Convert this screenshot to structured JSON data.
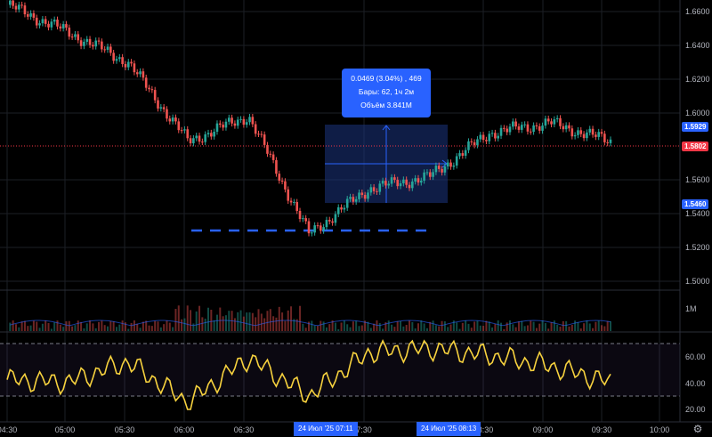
{
  "price_axis": {
    "ticks": [
      "1.6600",
      "1.6400",
      "1.6200",
      "1.6000",
      "1.5600",
      "1.5400",
      "1.5200",
      "1.5000"
    ],
    "tags": {
      "high": {
        "text": "1.5929",
        "color": "#2962ff"
      },
      "current": {
        "text": "1.5802",
        "color": "#f23645"
      },
      "low": {
        "text": "1.5460",
        "color": "#2962ff"
      }
    }
  },
  "volume_axis": {
    "label": "1M"
  },
  "rsi_axis": {
    "ticks": [
      "60.00",
      "40.00",
      "20.00"
    ]
  },
  "time_axis": {
    "labels": [
      "04:30",
      "05:00",
      "05:30",
      "06:00",
      "06:30",
      "7:30",
      "08:30",
      "09:00",
      "09:30",
      "10:00"
    ],
    "start_tag": "24 Июл '25   07:11",
    "end_tag": "24 Июл '25   08:13"
  },
  "measure": {
    "line1": "0.0469 (3.04%) , 469",
    "line2": "Бары: 62, 1ч 2м",
    "line3": "Объём 3.841M"
  },
  "colors": {
    "up": "#26a69a",
    "down": "#ef5350",
    "rsi": "#f7d23e",
    "accent": "#2962ff",
    "current_line": "#f23645"
  },
  "chart_data": {
    "type": "candlestick",
    "x": [
      "04:30",
      "05:00",
      "05:30",
      "06:00",
      "06:30",
      "07:00",
      "07:30",
      "08:00",
      "08:30",
      "09:00",
      "09:30"
    ],
    "price": [
      1.664,
      1.648,
      1.63,
      1.583,
      1.598,
      1.528,
      1.555,
      1.562,
      1.588,
      1.594,
      1.583
    ],
    "rsi": [
      42,
      40,
      55,
      25,
      58,
      30,
      62,
      65,
      60,
      52,
      40
    ],
    "ylim_price": [
      1.495,
      1.668
    ],
    "ylim_rsi": [
      20,
      72
    ],
    "rsi_bands": [
      70,
      30
    ],
    "horizontal_line": 1.531,
    "measure_range": {
      "from": 1.546,
      "to": 1.5929,
      "start": "07:11",
      "end": "08:13"
    }
  }
}
